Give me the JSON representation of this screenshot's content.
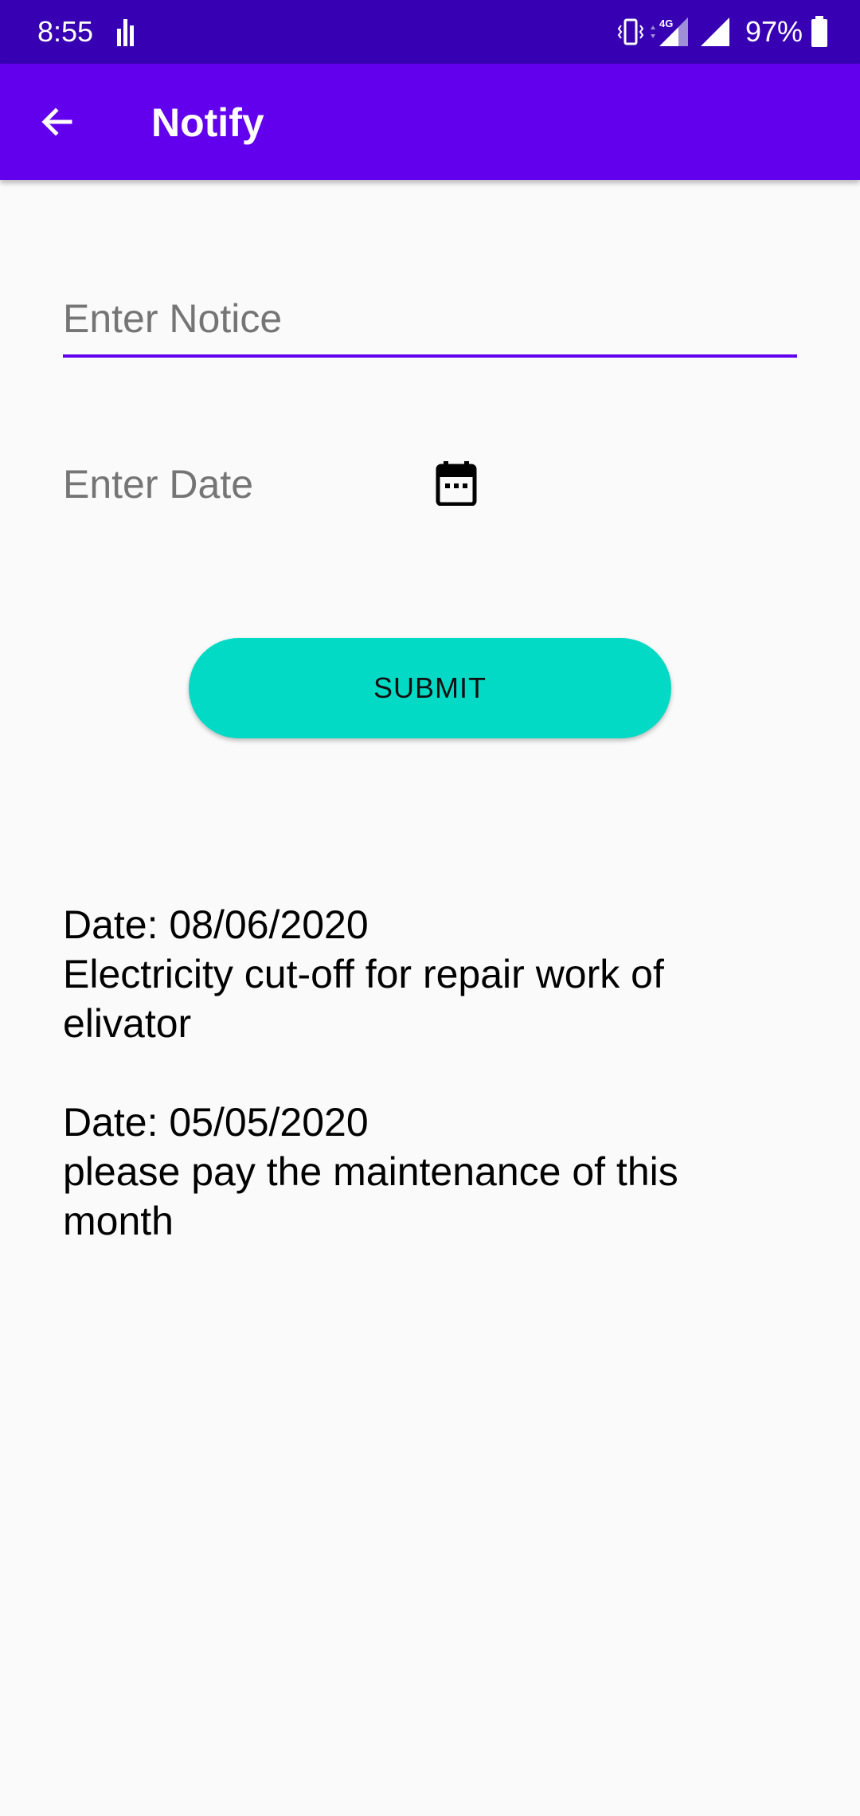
{
  "status_bar": {
    "time": "8:55",
    "network": "4G",
    "battery": "97%"
  },
  "app_bar": {
    "title": "Notify",
    "back_icon": "arrow-back-icon"
  },
  "form": {
    "notice_placeholder": "Enter Notice",
    "notice_value": "",
    "date_placeholder": "Enter Date",
    "calendar_icon": "calendar-icon",
    "submit_label": "SUBMIT"
  },
  "notices": [
    {
      "date": "Date: 08/06/2020",
      "text": "Electricity cut-off for repair work of elivator"
    },
    {
      "date": "Date: 05/05/2020",
      "text": "please pay the maintenance of this month"
    }
  ],
  "colors": {
    "status_bar": "#3700b3",
    "app_bar": "#6200ee",
    "accent": "#03dac5",
    "background": "#fafafa",
    "hint_text": "#757575"
  }
}
